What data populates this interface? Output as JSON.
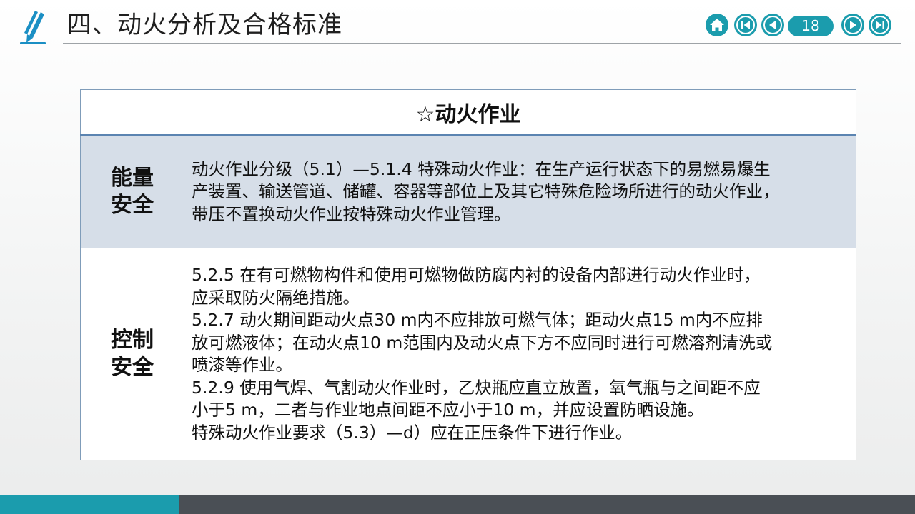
{
  "slide": {
    "title": "四、动火分析及合格标准",
    "page_number": "18"
  },
  "nav": {
    "buttons": [
      "home-icon",
      "first-page-icon",
      "previous-page-icon",
      "next-page-icon",
      "last-page-icon"
    ],
    "color": "#1b9cad"
  },
  "table": {
    "header": "☆动火作业",
    "rows": [
      {
        "label_line1": "能量",
        "label_line2": "安全",
        "lines": [
          "动火作业分级（5.1）—5.1.4  特殊动火作业：在生产运行状态下的易燃易爆生",
          "产装置、输送管道、储罐、容器等部位上及其它特殊危险场所进行的动火作业，",
          "带压不置换动火作业按特殊动火作业管理。"
        ]
      },
      {
        "label_line1": "控制",
        "label_line2": "安全",
        "lines": [
          "5.2.5  在有可燃物构件和使用可燃物做防腐内衬的设备内部进行动火作业时，",
          "应采取防火隔绝措施。",
          "5.2.7  动火期间距动火点30 m内不应排放可燃气体；距动火点15 m内不应排",
          "放可燃液体；在动火点10 m范围内及动火点下方不应同时进行可燃溶剂清洗或",
          "喷漆等作业。",
          "5.2.9  使用气焊、气割动火作业时，乙炔瓶应直立放置，氧气瓶与之间距不应",
          "小于5 m，二者与作业地点间距不应小于10 m，并应设置防晒设施。",
          "特殊动火作业要求（5.3）—d）应在正压条件下进行作业。"
        ]
      }
    ]
  },
  "colors": {
    "accent": "#1b9cad",
    "table_header_border": "#5b84b1",
    "row_highlight": "#d6dee8",
    "footer_dark": "#4a4f55"
  }
}
